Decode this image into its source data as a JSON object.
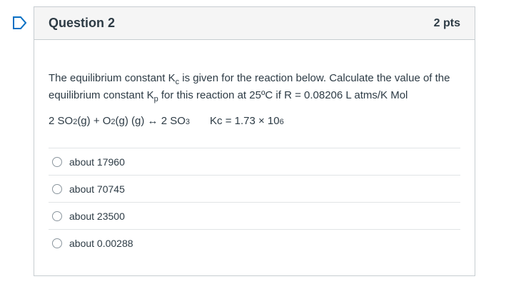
{
  "question": {
    "title": "Question 2",
    "points": "2 pts",
    "text_part1": "The equilibrium constant K",
    "text_sub1": "c",
    "text_part2": " is given for the reaction below.  Calculate the value of the equilibrium constant K",
    "text_sub2": "p",
    "text_part3": " for this reaction at 25ºC if R = 0.08206 L atms/K Mol",
    "equation": {
      "a": "2 SO",
      "a_sub": "2",
      "b": "(g) + O",
      "b_sub": "2",
      "c": "(g) (g) ↔ 2 SO",
      "c_sub": "3",
      "kc": "Kc = 1.73 × 10",
      "kc_sup": "6"
    }
  },
  "answers": [
    {
      "label": "about 17960"
    },
    {
      "label": "about 70745"
    },
    {
      "label": "about 23500"
    },
    {
      "label": "about 0.00288"
    }
  ],
  "colors": {
    "flag": "#0770c4",
    "header_bg": "#f5f5f5",
    "border": "#c7cdd1",
    "text": "#2d3b45"
  },
  "icons": {
    "flag": "bookmark-flag-icon"
  }
}
